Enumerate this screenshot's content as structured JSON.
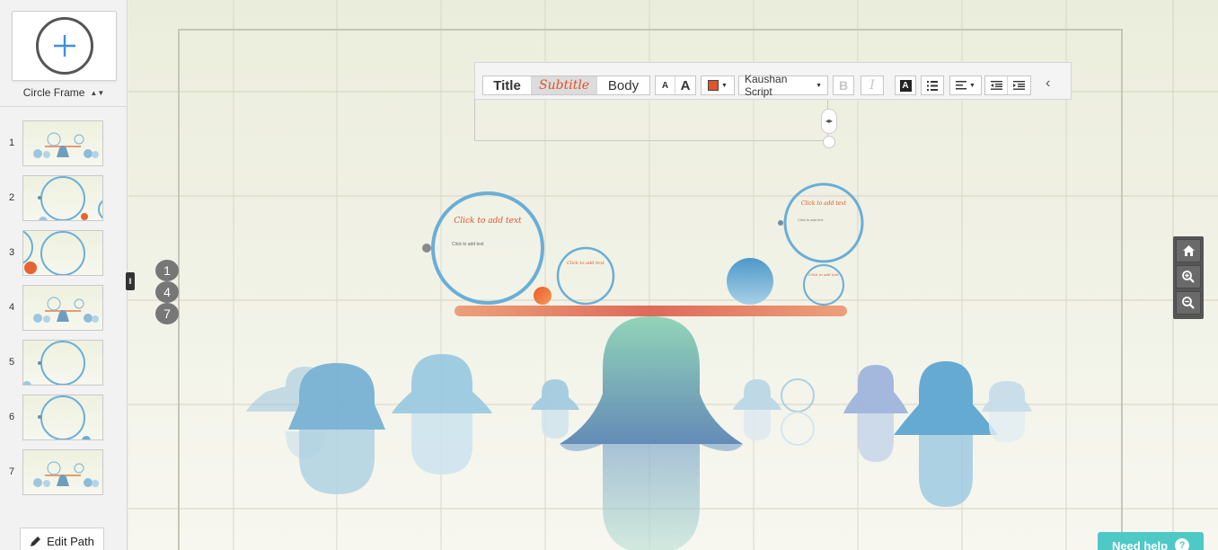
{
  "sidebar": {
    "frame_type": "Circle Frame",
    "thumbnails": [
      {
        "number": "1"
      },
      {
        "number": "2"
      },
      {
        "number": "3"
      },
      {
        "number": "4"
      },
      {
        "number": "5"
      },
      {
        "number": "6"
      },
      {
        "number": "7"
      }
    ],
    "edit_path_label": "Edit Path"
  },
  "canvas": {
    "path_badges": [
      "1",
      "4",
      "7"
    ],
    "placeholders": {
      "title": "Click to add text",
      "body": "Click to add text"
    }
  },
  "toolbar": {
    "styles": [
      "Title",
      "Subtitle",
      "Body"
    ],
    "selected_style": "Subtitle",
    "font_size_small": "A",
    "font_size_large": "A",
    "font_name": "Kaushan Script",
    "text_color": "#e0542a",
    "bold": "B",
    "italic": "I",
    "highlight": "A"
  },
  "help": {
    "label": "Need help",
    "icon": "?"
  },
  "colors": {
    "accent_orange": "#e0542a",
    "frame_blue": "#6aaed6",
    "help_teal": "#4ec9c6"
  }
}
